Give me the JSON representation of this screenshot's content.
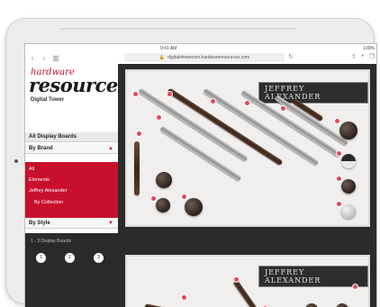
{
  "browser": {
    "status_time": "9:41 AM",
    "status_battery": "100%",
    "url": "digitalshowroom.hardwareresources.com",
    "nav": {
      "back": "‹",
      "forward": "›",
      "bookmarks": "▥"
    },
    "reload": "↻",
    "actions": {
      "share": "⇧",
      "add": "+",
      "tabs": "❐"
    }
  },
  "sidebar": {
    "logo_script": "hardware",
    "logo_main": "resources",
    "logo_sub": "Digital Tower",
    "sections": [
      {
        "label": "All Display Boards"
      },
      {
        "label": "By Brand",
        "caret": "▲"
      }
    ],
    "brand_items": [
      {
        "label": "All"
      },
      {
        "label": "Elements"
      },
      {
        "label": "Jeffrey Alexander"
      },
      {
        "label": "By Collection",
        "caret": "▲"
      }
    ],
    "style_section": {
      "label": "By Style",
      "caret": "▼"
    },
    "dark_label": "1 - 3 Display Boards",
    "pagination": [
      "1",
      "2",
      "3"
    ]
  },
  "main": {
    "board_brand": "JEFFREY ALEXANDER",
    "board2_brand": "JEFFREY ALEXANDER"
  },
  "colors": {
    "accent": "#c8102e",
    "sidebar_dark": "#2a2a2a",
    "board_bg": "#f1efed",
    "tag": "#e8455a"
  }
}
